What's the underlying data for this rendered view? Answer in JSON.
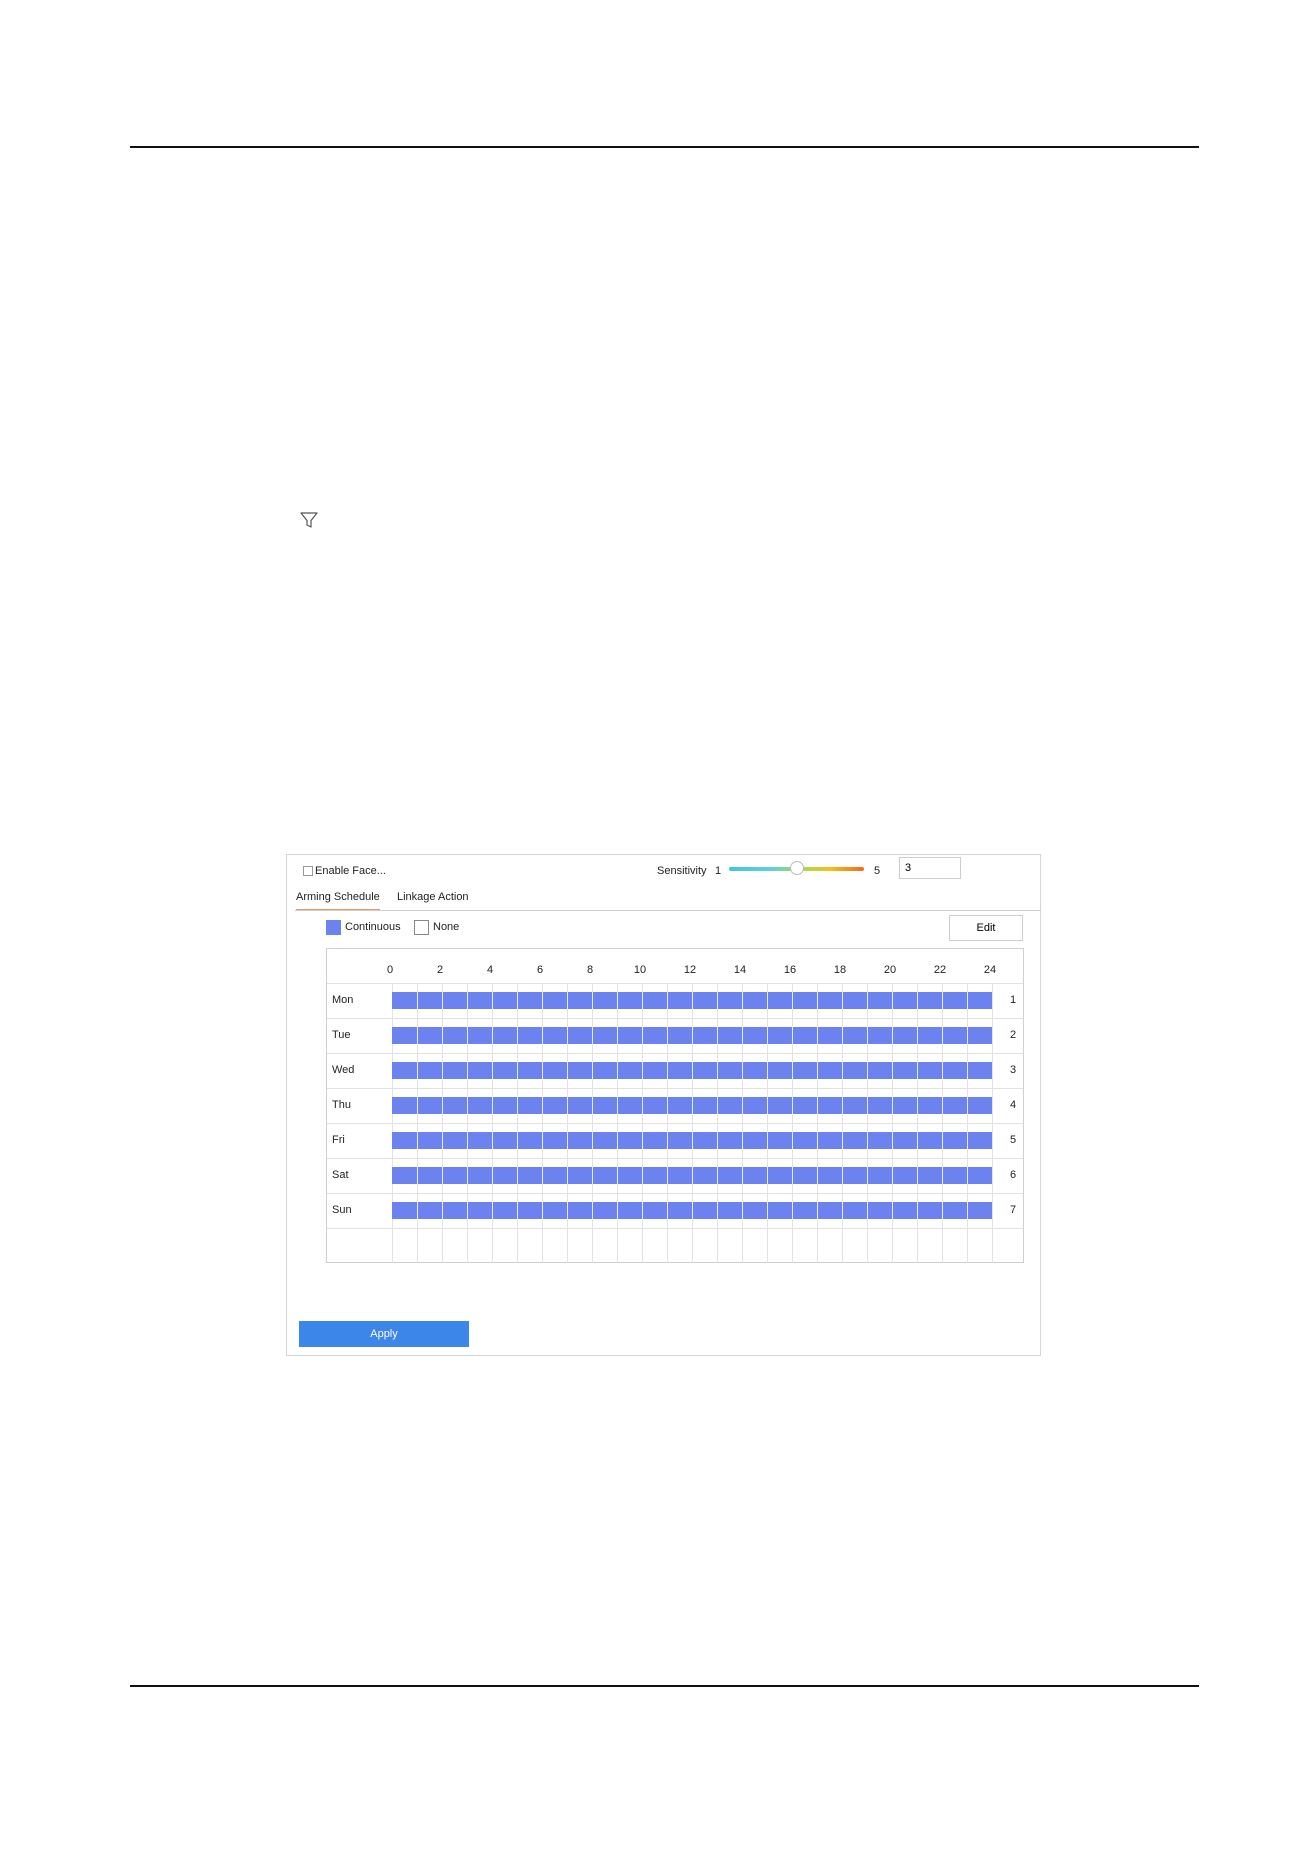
{
  "panel": {
    "enable_label": "Enable Face...",
    "sensitivity": {
      "label": "Sensitivity",
      "min": "1",
      "max": "5",
      "value": "3",
      "level": 3
    },
    "tabs": [
      {
        "label": "Arming Schedule",
        "active": true
      },
      {
        "label": "Linkage Action",
        "active": false
      }
    ],
    "legend": {
      "continuous": "Continuous",
      "none": "None",
      "continuous_color": "#6c82ee"
    },
    "edit_label": "Edit",
    "apply_label": "Apply",
    "apply_color": "#3b86e8",
    "schedule": {
      "hours": [
        "0",
        "2",
        "4",
        "6",
        "8",
        "10",
        "12",
        "14",
        "16",
        "18",
        "20",
        "22",
        "24"
      ],
      "days": [
        {
          "name": "Mon",
          "num": "1",
          "start": 0,
          "end": 24
        },
        {
          "name": "Tue",
          "num": "2",
          "start": 0,
          "end": 24
        },
        {
          "name": "Wed",
          "num": "3",
          "start": 0,
          "end": 24
        },
        {
          "name": "Thu",
          "num": "4",
          "start": 0,
          "end": 24
        },
        {
          "name": "Fri",
          "num": "5",
          "start": 0,
          "end": 24
        },
        {
          "name": "Sat",
          "num": "6",
          "start": 0,
          "end": 24
        },
        {
          "name": "Sun",
          "num": "7",
          "start": 0,
          "end": 24
        }
      ]
    }
  }
}
